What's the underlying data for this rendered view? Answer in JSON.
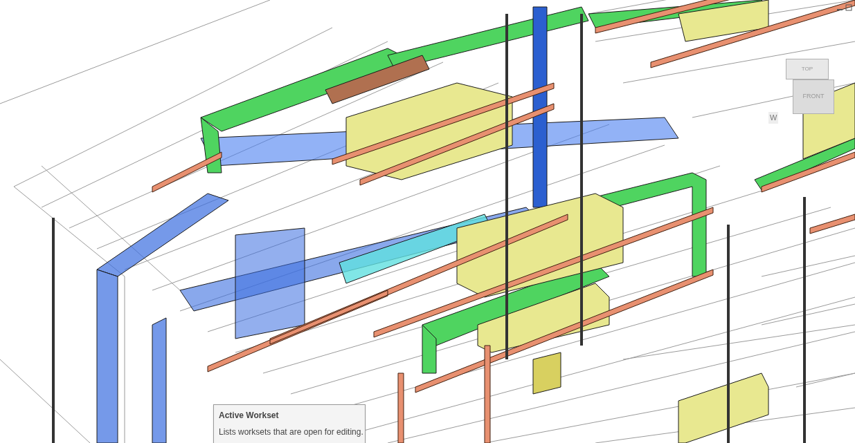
{
  "viewport": {
    "view_cube": {
      "faces": [
        "TOP",
        "FRONT"
      ],
      "compass": [
        "W"
      ]
    }
  },
  "tooltip": {
    "title": "Active Workset",
    "description": "Lists worksets that are open for editing."
  }
}
